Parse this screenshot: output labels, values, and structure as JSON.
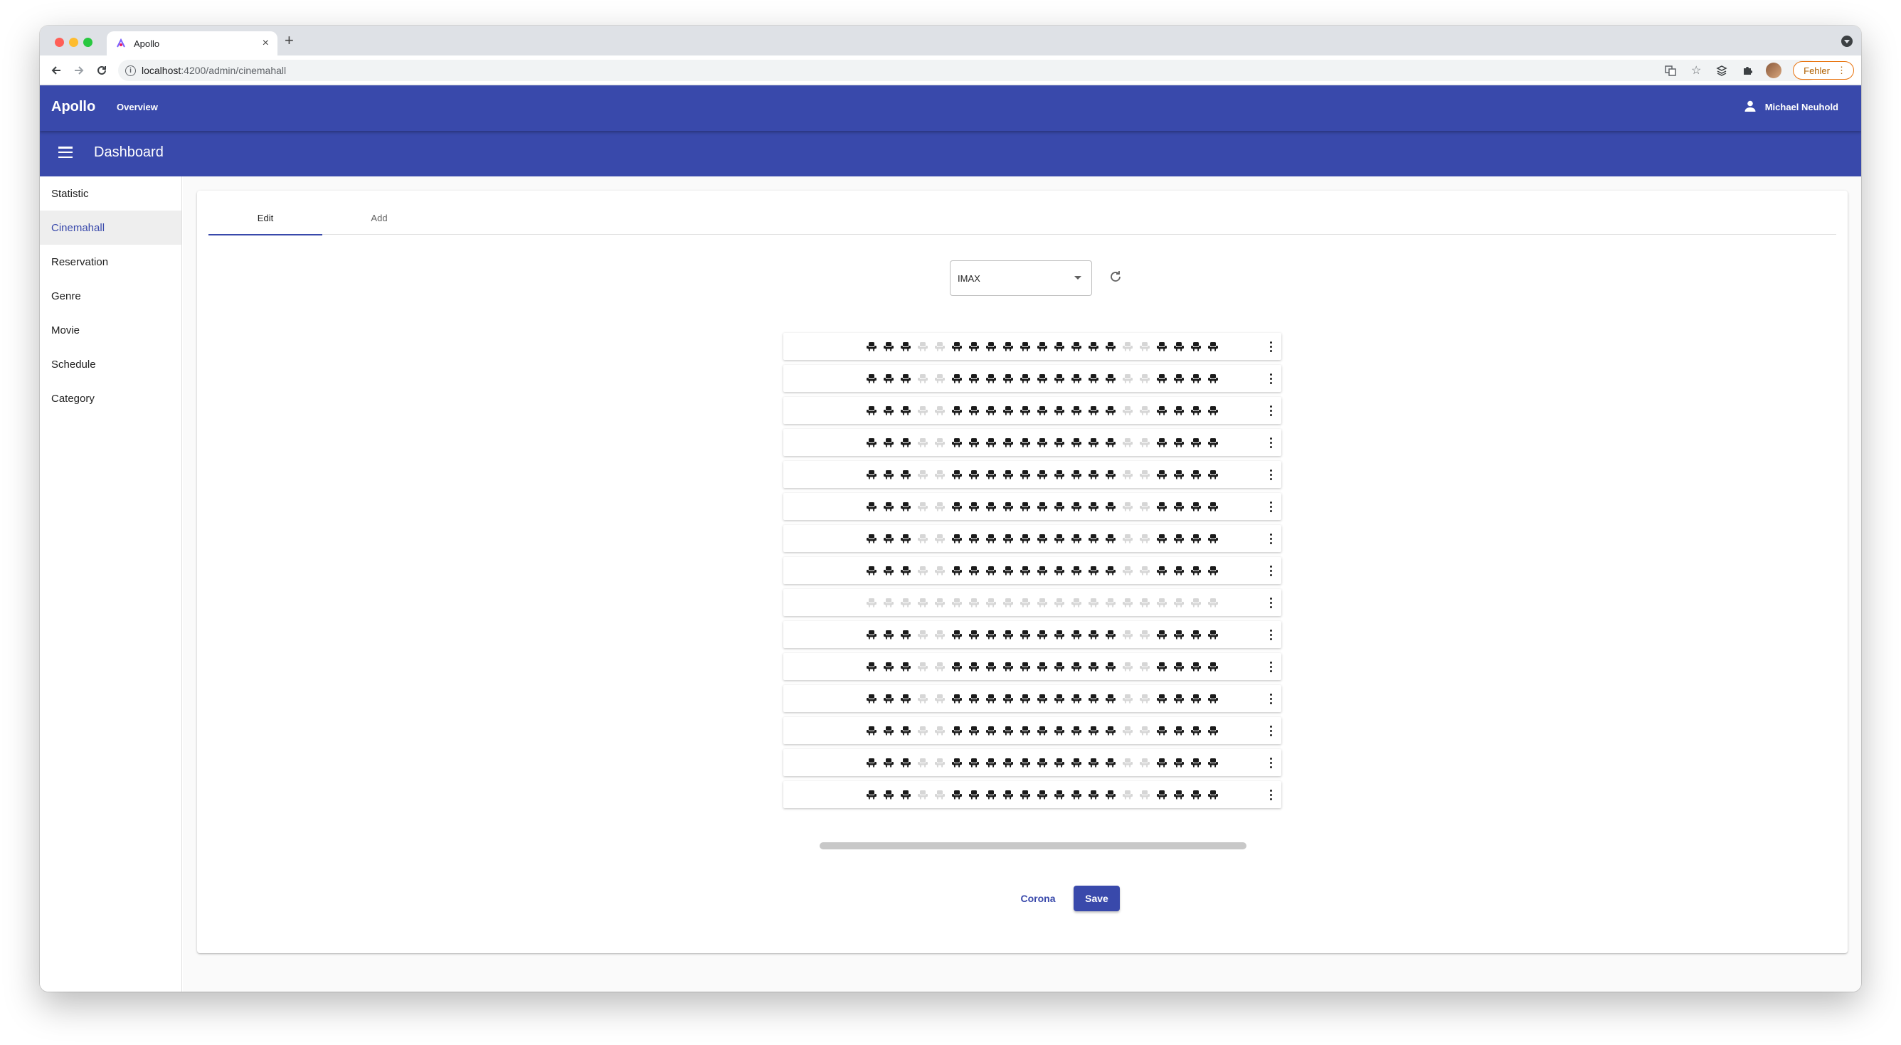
{
  "browser": {
    "tab_title": "Apollo",
    "url_host": "localhost",
    "url_path": ":4200/admin/cinemahall",
    "error_button": "Fehler"
  },
  "app": {
    "brand": "Apollo",
    "nav_overview": "Overview",
    "user_name": "Michael Neuhold",
    "page_title": "Dashboard",
    "accent_color": "#3949ab"
  },
  "sidebar": {
    "items": [
      {
        "label": "Statistic",
        "active": false
      },
      {
        "label": "Cinemahall",
        "active": true
      },
      {
        "label": "Reservation",
        "active": false
      },
      {
        "label": "Genre",
        "active": false
      },
      {
        "label": "Movie",
        "active": false
      },
      {
        "label": "Schedule",
        "active": false
      },
      {
        "label": "Category",
        "active": false
      }
    ]
  },
  "tabs": {
    "edit": "Edit",
    "add": "Add",
    "active": "Edit"
  },
  "hall_select": {
    "value": "IMAX"
  },
  "seat_grid": {
    "seat_icon": "seat-icon",
    "rows": [
      "111001111111111001111",
      "111001111111111001111",
      "111001111111111001111",
      "111001111111111001111",
      "111001111111111001111",
      "111001111111111001111",
      "111001111111111001111",
      "111001111111111001111",
      "000000000000000000000",
      "111001111111111001111",
      "111001111111111001111",
      "111001111111111001111",
      "111001111111111001111",
      "111001111111111001111",
      "111001111111111001111"
    ]
  },
  "actions": {
    "corona": "Corona",
    "save": "Save"
  }
}
